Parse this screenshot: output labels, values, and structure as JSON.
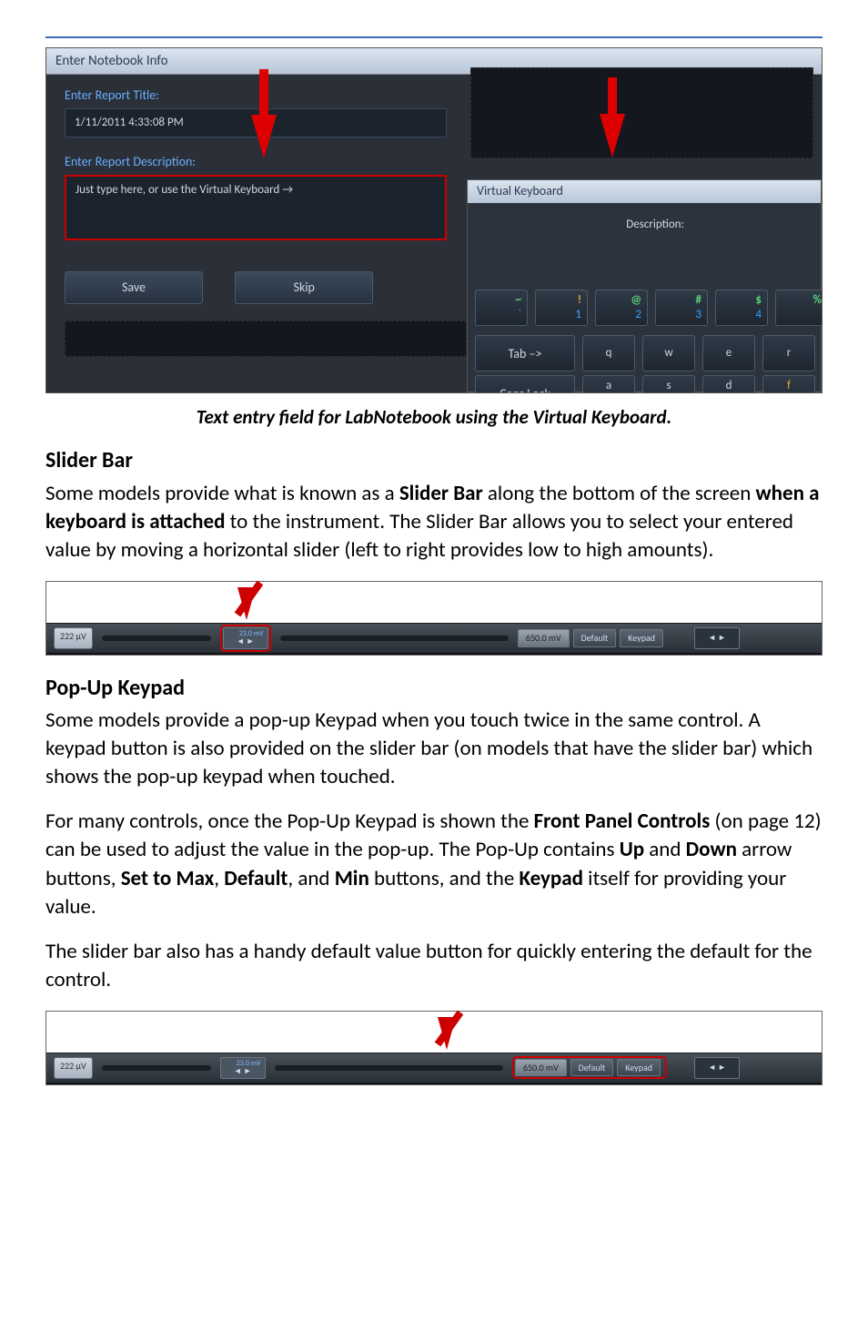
{
  "screenshot1": {
    "window_title": "Enter Notebook Info",
    "title_label": "Enter Report Title:",
    "title_value": "1/11/2011 4:33:08 PM",
    "desc_label": "Enter Report Description:",
    "desc_placeholder": "Just type here, or use the Virtual Keyboard →",
    "save": "Save",
    "skip": "Skip",
    "vk_title": "Virtual Keyboard",
    "vk_desc_label": "Description:",
    "keys_row1": [
      {
        "top": "~",
        "bot": "`",
        "topcolor": "green"
      },
      {
        "top": "!",
        "bot": "1",
        "topcolor": "orange"
      },
      {
        "top": "@",
        "bot": "2",
        "topcolor": "green"
      },
      {
        "top": "#",
        "bot": "3",
        "topcolor": "green"
      },
      {
        "top": "$",
        "bot": "4",
        "topcolor": "green"
      },
      {
        "top": "%",
        "bot": "",
        "topcolor": "green"
      }
    ],
    "tab": "Tab –>",
    "row2": [
      "q",
      "w",
      "e",
      "r"
    ],
    "caps": "Caps Lock",
    "row3": [
      "a",
      "s",
      "d",
      "f"
    ]
  },
  "caption1": "Text entry field for LabNotebook using the Virtual Keyboard.",
  "h_slider": "Slider Bar",
  "p_slider": "Some models provide what is known as a <b>Slider Bar</b> along the bottom of the screen <b>when a keyboard is attached</b> to the instrument. The Slider Bar allows you to select your entered value by moving a horizontal slider (left to right provides low to high amounts).",
  "sliderfig": {
    "leftchip": "222 µV",
    "mini_mv": "23.0 mV",
    "mini_ar": "◄ ►",
    "valbtn": "650.0 mV",
    "default": "Default",
    "keypad": "Keypad",
    "rarrows": "◄ ►"
  },
  "h_popup": "Pop-Up Keypad",
  "p_popup1": "Some models provide a pop-up Keypad when you touch twice in the same control. A keypad button is also provided on the slider bar (on models that have the slider bar) which shows the pop-up keypad when touched.",
  "p_popup2": "For many controls, once the Pop-Up Keypad is shown the <b>Front Panel Controls</b> (on page 12) can be used to adjust the value in the pop-up. The Pop-Up contains <b>Up</b> and <b>Down</b> arrow buttons, <b>Set to Max</b>, <b>Default</b>, and <b>Min</b> buttons, and the <b>Keypad</b> itself for providing your value.",
  "p_popup3": "The slider bar also has a handy default value button for quickly entering the default for the control."
}
